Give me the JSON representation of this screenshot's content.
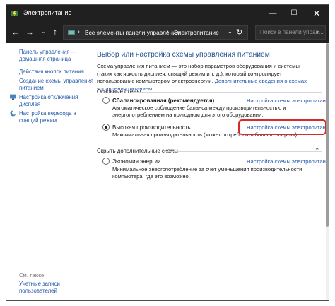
{
  "window": {
    "title": "Электропитание",
    "controls": {
      "minimize": "—",
      "maximize": "☐",
      "close": "✕"
    }
  },
  "nav": {
    "back": "←",
    "forward": "→",
    "history": "⌄",
    "up": "↑"
  },
  "address": {
    "separator": "›",
    "crumbs": [
      "Все элементы панели управления",
      "Электропитание"
    ],
    "dropdown": "⌄",
    "refresh": "↻"
  },
  "search": {
    "placeholder": "Поиск в панели управ...",
    "icon": "⌕"
  },
  "sidebar": {
    "links": [
      {
        "label": "Панель управления —\nдомашняя страница"
      },
      {
        "label": "Действия кнопок питания"
      },
      {
        "label": "Создание схемы управления\nпитанием"
      },
      {
        "label": "Настройка отключения\nдисплея"
      },
      {
        "label": "Настройка перехода в\nспящий режим"
      }
    ],
    "see_also": "См. также",
    "user_accounts": "Учетные записи\nпользователей"
  },
  "main": {
    "heading": "Выбор или настройка схемы управления питанием",
    "intro": "Схема управления питанием — это набор параметров оборудования и системы (таких как яркость дисплея, спящий режим и т. д.), который контролирует использование компьютером электроэнергии.",
    "intro_link": "Дополнительные сведения о схемах управления питанием",
    "main_group": "Основные схемы",
    "plans": [
      {
        "name": "Сбалансированная (рекомендуется)",
        "desc": "Автоматическое соблюдение баланса между производительностью и энергопотреблением на пригодном для этого оборудовании.",
        "link": "Настройка схемы электропитания",
        "selected": false
      },
      {
        "name": "Высокая производительность",
        "desc": "Максимальная производительность (может потребовать больше энергии)",
        "link": "Настройка схемы электропитания",
        "selected": true
      }
    ],
    "hidden_group": "Скрыть дополнительные схемы",
    "hidden_plans": [
      {
        "name": "Экономия энергии",
        "desc": "Минимальное энергопотребление за счет уменьшения производительности компьютера, где это возможно.",
        "link": "Настройка схемы электропитания",
        "selected": false
      }
    ],
    "collapse_icon": "⌃"
  },
  "colors": {
    "titlebar": "#202020",
    "link": "#2358a8",
    "heading": "#1f4f8f",
    "highlight": "#d62b2b"
  }
}
